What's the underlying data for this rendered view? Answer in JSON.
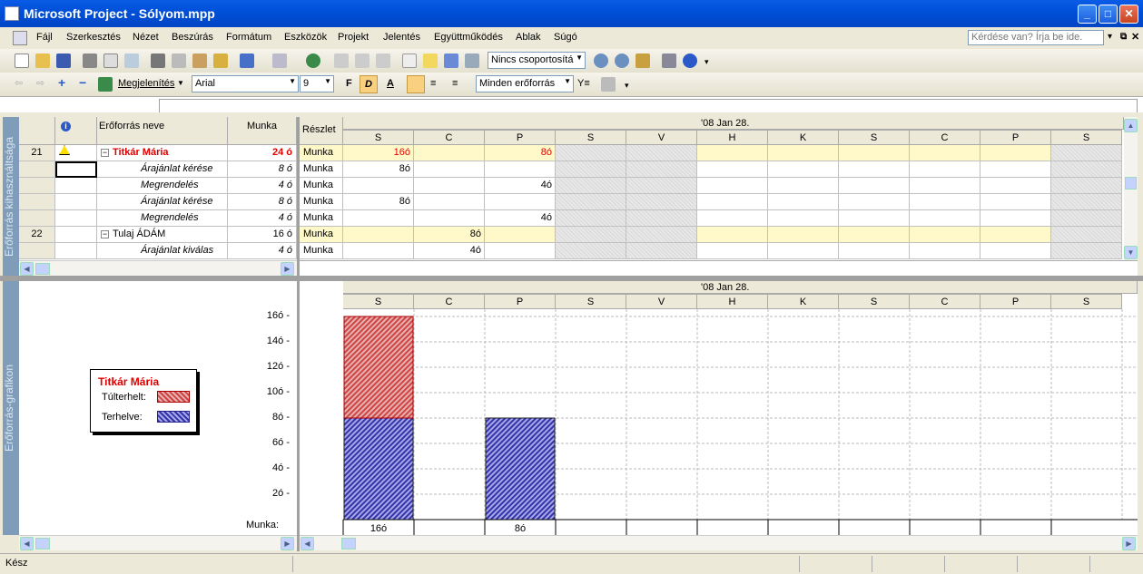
{
  "window": {
    "title": "Microsoft Project - Sólyom.mpp"
  },
  "menu": [
    "Fájl",
    "Szerkesztés",
    "Nézet",
    "Beszúrás",
    "Formátum",
    "Eszközök",
    "Projekt",
    "Jelentés",
    "Együttműködés",
    "Ablak",
    "Súgó"
  ],
  "help_placeholder": "Kérdése van? Írja be ide.",
  "toolbar": {
    "group_combo": "Nincs csoportosítá",
    "view_label": "Megjelenítés",
    "font": "Arial",
    "size": "9",
    "bold": "F",
    "italic": "D",
    "underline": "A",
    "filter": "Minden erőforrás"
  },
  "usage": {
    "sidebar_label": "Erőforrás kihasználtsága",
    "headers": {
      "name": "Erőforrás neve",
      "work": "Munka",
      "details": "Részlet"
    },
    "timescale_top": "'08 Jan 28.",
    "days": [
      "S",
      "C",
      "P",
      "S",
      "V",
      "H",
      "K",
      "S",
      "C",
      "P",
      "S"
    ],
    "rows": [
      {
        "num": "21",
        "name": "Titkár Mária",
        "work": "24 ó",
        "kind": "resource",
        "over": true,
        "detail": "Munka",
        "values": [
          "16ó",
          "",
          "8ó",
          "",
          "",
          "",
          "",
          "",
          "",
          "",
          ""
        ]
      },
      {
        "num": "",
        "name": "Árajánlat kérése",
        "work": "8 ó",
        "kind": "task",
        "detail": "Munka",
        "values": [
          "8ó",
          "",
          "",
          "",
          "",
          "",
          "",
          "",
          "",
          "",
          ""
        ]
      },
      {
        "num": "",
        "name": "Megrendelés",
        "work": "4 ó",
        "kind": "task",
        "detail": "Munka",
        "values": [
          "",
          "",
          "4ó",
          "",
          "",
          "",
          "",
          "",
          "",
          "",
          ""
        ]
      },
      {
        "num": "",
        "name": "Árajánlat kérése",
        "work": "8 ó",
        "kind": "task",
        "detail": "Munka",
        "values": [
          "8ó",
          "",
          "",
          "",
          "",
          "",
          "",
          "",
          "",
          "",
          ""
        ]
      },
      {
        "num": "",
        "name": "Megrendelés",
        "work": "4 ó",
        "kind": "task",
        "detail": "Munka",
        "values": [
          "",
          "",
          "4ó",
          "",
          "",
          "",
          "",
          "",
          "",
          "",
          ""
        ]
      },
      {
        "num": "22",
        "name": "Tulaj ÁDÁM",
        "work": "16 ó",
        "kind": "resource",
        "over": false,
        "detail": "Munka",
        "values": [
          "",
          "8ó",
          "",
          "",
          "",
          "",
          "",
          "",
          "",
          "",
          ""
        ]
      },
      {
        "num": "",
        "name": "Árajánlat kiválas",
        "work": "4 ó",
        "kind": "task",
        "detail": "Munka",
        "values": [
          "",
          "4ó",
          "",
          "",
          "",
          "",
          "",
          "",
          "",
          "",
          ""
        ]
      }
    ]
  },
  "graph": {
    "sidebar_label": "Erőforrás-grafikon",
    "legend": {
      "title": "Titkár Mária",
      "over": "Túlterhelt:",
      "alloc": "Terhelve:"
    },
    "work_label": "Munka:",
    "totals": [
      "16ó",
      "",
      "8ó",
      "",
      "",
      "",
      "",
      "",
      "",
      "",
      ""
    ]
  },
  "chart_data": {
    "type": "bar",
    "categories": [
      "S",
      "C",
      "P",
      "S",
      "V",
      "H",
      "K",
      "S",
      "C",
      "P",
      "S"
    ],
    "series": [
      {
        "name": "Terhelve",
        "values": [
          8,
          0,
          8,
          0,
          0,
          0,
          0,
          0,
          0,
          0,
          0
        ]
      },
      {
        "name": "Túlterhelt",
        "values": [
          8,
          0,
          0,
          0,
          0,
          0,
          0,
          0,
          0,
          0,
          0
        ]
      }
    ],
    "yticks": [
      "2ó",
      "4ó",
      "6ó",
      "8ó",
      "10ó",
      "12ó",
      "14ó",
      "16ó"
    ],
    "ylim": [
      0,
      16
    ],
    "colors": {
      "over": "#cc4444",
      "alloc": "#3333aa"
    }
  },
  "status": "Kész"
}
